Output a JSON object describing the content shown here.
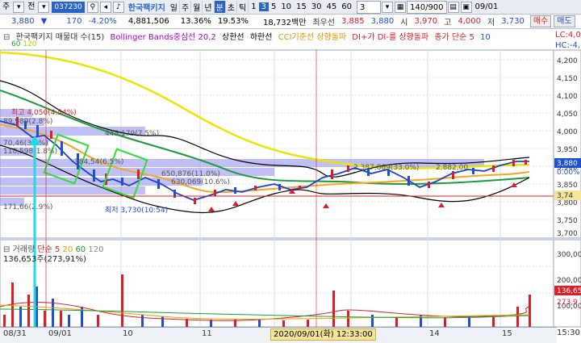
{
  "toolbar": {
    "menu_label": "주",
    "all_label": "전",
    "code": "037230",
    "stock_name": "한국팩키지",
    "tabs": [
      "일",
      "주",
      "월",
      "년",
      "분",
      "초",
      "틱"
    ],
    "selected_tab": "분",
    "numbers": [
      "1",
      "3",
      "5",
      "10",
      "15",
      "30",
      "45",
      "60"
    ],
    "selected_number": "3",
    "count": "3",
    "range": "140/900",
    "date": "09/01"
  },
  "quote": {
    "price": "3,880",
    "change": "170",
    "change_pct": "-4.20%",
    "volume": "4,881,506",
    "ratio1": "13.36%",
    "ratio2": "19.53%",
    "trade_amount": "18,732백만",
    "best_ask_label": "최우선",
    "best_ask": "3,885",
    "best_bid": "3,880",
    "open_label": "시",
    "open": "3,970",
    "high_label": "고",
    "high": "4,000",
    "low_label": "저",
    "low": "3,730",
    "buy_button": "매수",
    "sell_button": "매도"
  },
  "legend": {
    "item1": "한국팩키지 매물대 수(15)",
    "item2": "Bollinger Bands중심선 20,2",
    "item3": "상한선",
    "item4": "하한선",
    "item5": "CCI기준선 상향돌파",
    "item6": "DI+가 DI-를 상향돌파",
    "item7": "종가 단순 5",
    "item8": "10",
    "item9": "60",
    "item10": "120",
    "right_top": "LC:4,0",
    "right_bottom": "HC:-4,"
  },
  "price_axis": {
    "ticks": [
      "4,200",
      "4,150",
      "4,100",
      "4,050",
      "4,000",
      "3,950",
      "3,900",
      "3,850",
      "3,800",
      "3,750",
      "3,700"
    ],
    "current_price": "3,880",
    "current_pct": "0.00%",
    "ref_price": "3,74"
  },
  "volume_axis": {
    "ticks": [
      "300,000",
      "200,000",
      "100,000"
    ],
    "current_vol": "136,65",
    "current_pct": "273,9"
  },
  "volume_legend": {
    "label": "거래량",
    "sma": "단순 5",
    "p20": "20",
    "p60": "60",
    "p120": "120",
    "max_info": "136,653주(273,91%)"
  },
  "annotations": {
    "high_label": "최고 4,050(4.54%)",
    "vp1": "445,179(7.5%)",
    "vp2": "384,54(6.5%)",
    "vp3": "650,876(11.0%)",
    "vp4": "630,069(10.6%)",
    "vp5": "171,66(2.9%)",
    "vp6": "2,387,869(33.0%)",
    "vp7": "2,882,00",
    "low_label": "최저 3,730(10:54)",
    "left_labels": [
      "89,989(2.8%)",
      "70,46(3.5%)",
      "118,598(1.8%)"
    ]
  },
  "x_axis": {
    "ticks": [
      "08/31",
      "09/01",
      "10",
      "11",
      "14",
      "15",
      "15:30"
    ],
    "highlight": "2020/09/01(화) 12:33:00"
  },
  "colors": {
    "accent": "#2b64c8",
    "bollinger": "#000000",
    "ma5": "#1d3fd0",
    "ma20": "#f5a623",
    "ma60": "#1a9a3a",
    "ma120": "#e8e600",
    "volume_up": "#d8202a",
    "volume_down": "#1d4fd0",
    "highlight_box": "#33dd33",
    "cursor_arrow": "#20d8e8",
    "profile_bar": "#8c8cf0"
  }
}
